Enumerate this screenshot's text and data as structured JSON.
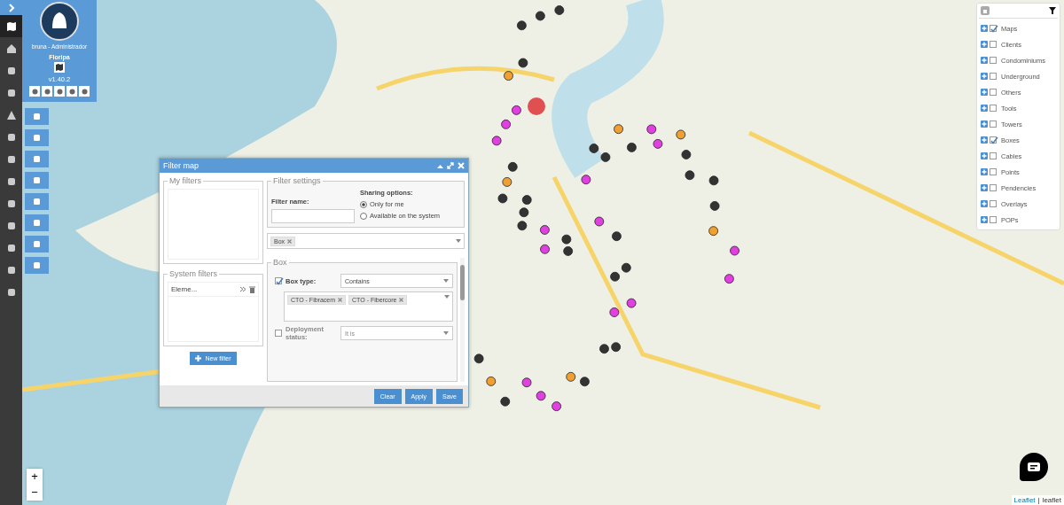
{
  "sidebar": {
    "user": "bruna - Administrador",
    "map_name": "Floripa",
    "version": "v1.40.2"
  },
  "dialog": {
    "title": "Filter map",
    "my_filters_legend": "My filters",
    "system_filters_legend": "System filters",
    "system_filters": [
      {
        "label": "Eleme..."
      }
    ],
    "new_filter_button": "New filter",
    "settings_legend": "Filter settings",
    "filter_name_label": "Filter name:",
    "sharing_label": "Sharing options:",
    "sharing_options": [
      {
        "label": "Only for me",
        "selected": true
      },
      {
        "label": "Available on the system",
        "selected": false
      }
    ],
    "types": [
      "Box"
    ],
    "box_legend": "Box",
    "conditions": [
      {
        "label": "Box type:",
        "checked": true,
        "disabled": false,
        "operator": "Contains",
        "values": [
          "CTO - Fibracem",
          "CTO - Fibercore"
        ]
      },
      {
        "label": "Deployment status:",
        "checked": false,
        "disabled": true,
        "operator": "It is"
      }
    ],
    "buttons": [
      "Clear",
      "Apply",
      "Save"
    ]
  },
  "layers": [
    {
      "label": "Maps",
      "checked": true
    },
    {
      "label": "Clients",
      "checked": false
    },
    {
      "label": "Condominiums",
      "checked": false
    },
    {
      "label": "Underground",
      "checked": false
    },
    {
      "label": "Others",
      "checked": false
    },
    {
      "label": "Tools",
      "checked": false
    },
    {
      "label": "Towers",
      "checked": false
    },
    {
      "label": "Boxes",
      "checked": true
    },
    {
      "label": "Cables",
      "checked": false
    },
    {
      "label": "Points",
      "checked": false
    },
    {
      "label": "Pendencies",
      "checked": false
    },
    {
      "label": "Overlays",
      "checked": false
    },
    {
      "label": "POPs",
      "checked": false
    }
  ],
  "zoom": {
    "in": "+",
    "out": "−"
  },
  "attribution": [
    "Leaflet",
    "|",
    "leaflet"
  ]
}
